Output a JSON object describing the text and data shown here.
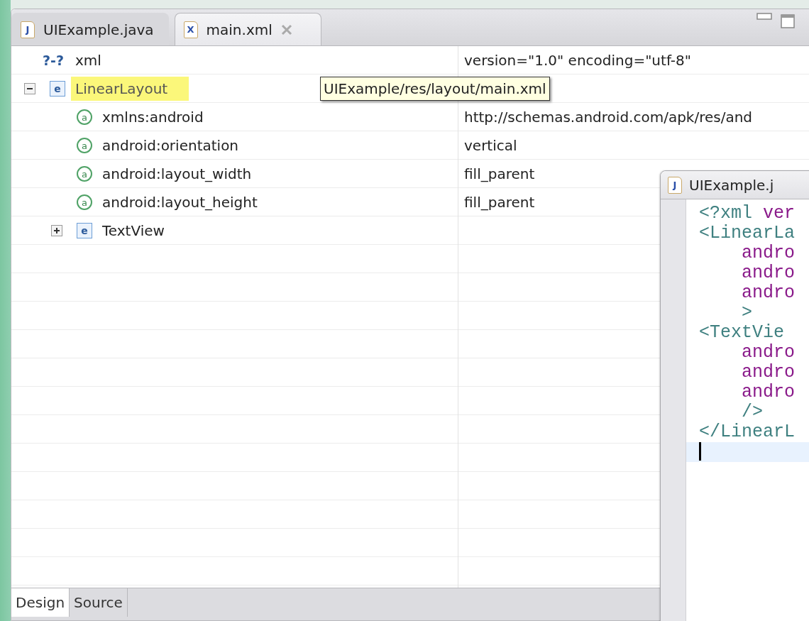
{
  "editor_tabs": [
    {
      "label": "UIExample.java",
      "icon_label": "J",
      "selected": false,
      "closable": false
    },
    {
      "label": "main.xml",
      "icon_label": "X",
      "selected": true,
      "closable": true
    }
  ],
  "tree": [
    {
      "kind": "instruction",
      "icon_label": "?-?",
      "name": "xml",
      "value": "version=\"1.0\" encoding=\"utf-8\"",
      "selected": false
    },
    {
      "kind": "element",
      "icon_label": "e",
      "name": "LinearLayout",
      "selected": true,
      "expanded": true,
      "children": [
        {
          "kind": "attribute",
          "icon_label": "a",
          "name": "xmlns:android",
          "value": "http://schemas.android.com/apk/res/and",
          "selected": false
        },
        {
          "kind": "attribute",
          "icon_label": "a",
          "name": "android:orientation",
          "value": "vertical",
          "selected": false
        },
        {
          "kind": "attribute",
          "icon_label": "a",
          "name": "android:layout_width",
          "value": "fill_parent",
          "selected": false
        },
        {
          "kind": "attribute",
          "icon_label": "a",
          "name": "android:layout_height",
          "value": "fill_parent",
          "selected": false
        },
        {
          "kind": "element",
          "icon_label": "e",
          "name": "TextView",
          "selected": false,
          "expanded": false
        }
      ]
    }
  ],
  "tooltip": "UIExample/res/layout/main.xml",
  "bottom_tabs": [
    {
      "label": "Design",
      "selected": true
    },
    {
      "label": "Source",
      "selected": false
    }
  ],
  "source_window": {
    "tab": {
      "label": "UIExample.j",
      "icon_label": "J"
    },
    "lines": [
      {
        "cursor": false,
        "segments": [
          {
            "kind": "tag",
            "text": "<?xml"
          },
          {
            "kind": "attr",
            "text": " ver"
          }
        ]
      },
      {
        "cursor": false,
        "segments": [
          {
            "kind": "tag",
            "text": "<LinearLa"
          }
        ]
      },
      {
        "cursor": false,
        "segments": [
          {
            "kind": "attr",
            "text": "    andro"
          }
        ]
      },
      {
        "cursor": false,
        "segments": [
          {
            "kind": "attr",
            "text": "    andro"
          }
        ]
      },
      {
        "cursor": false,
        "segments": [
          {
            "kind": "attr",
            "text": "    andro"
          }
        ]
      },
      {
        "cursor": false,
        "segments": [
          {
            "kind": "tag",
            "text": "    >"
          }
        ]
      },
      {
        "cursor": false,
        "segments": [
          {
            "kind": "tag",
            "text": "<TextVie"
          }
        ]
      },
      {
        "cursor": false,
        "segments": [
          {
            "kind": "attr",
            "text": "    andro"
          }
        ]
      },
      {
        "cursor": false,
        "segments": [
          {
            "kind": "attr",
            "text": "    andro"
          }
        ]
      },
      {
        "cursor": false,
        "segments": [
          {
            "kind": "attr",
            "text": "    andro"
          }
        ]
      },
      {
        "cursor": false,
        "segments": [
          {
            "kind": "tag",
            "text": "    />"
          }
        ]
      },
      {
        "cursor": false,
        "segments": [
          {
            "kind": "tag",
            "text": "</LinearL"
          }
        ]
      },
      {
        "cursor": true
      }
    ]
  }
}
